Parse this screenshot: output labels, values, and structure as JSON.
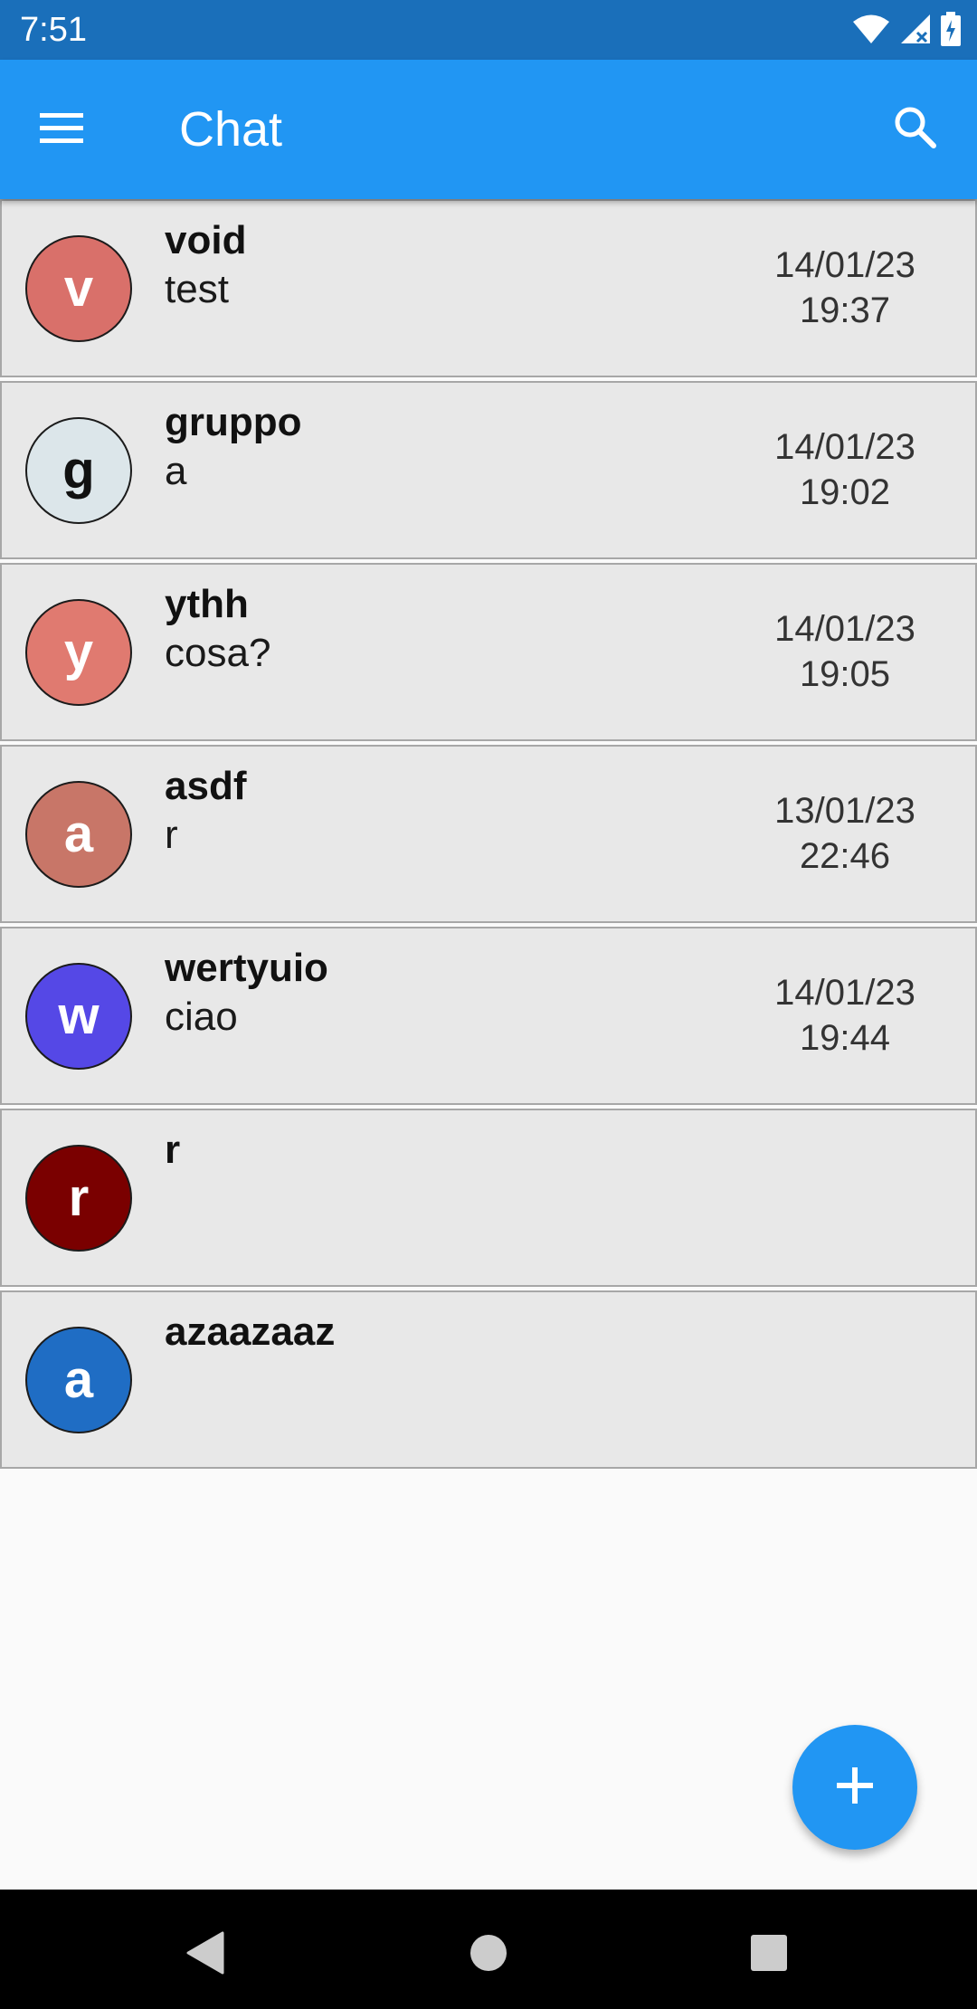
{
  "status_bar": {
    "time": "7:51",
    "icons": [
      "wifi-icon",
      "cellular-signal-icon",
      "battery-charging-icon"
    ]
  },
  "app_bar": {
    "title": "Chat",
    "menu_icon": "hamburger-menu-icon",
    "search_icon": "search-icon",
    "color": "#2196f3"
  },
  "chats": [
    {
      "initial": "v",
      "name": "void",
      "message": "test",
      "date": "14/01/23",
      "time": "19:37",
      "avatar_color": "#d9706a",
      "avatar_text_color": "#ffffff"
    },
    {
      "initial": "g",
      "name": "gruppo",
      "message": "a",
      "date": "14/01/23",
      "time": "19:02",
      "avatar_color": "#dce6ea",
      "avatar_text_color": "#111111"
    },
    {
      "initial": "y",
      "name": "ythh",
      "message": "cosa?",
      "date": "14/01/23",
      "time": "19:05",
      "avatar_color": "#e07a70",
      "avatar_text_color": "#ffffff"
    },
    {
      "initial": "a",
      "name": "asdf",
      "message": "r",
      "date": "13/01/23",
      "time": "22:46",
      "avatar_color": "#c87668",
      "avatar_text_color": "#ffffff"
    },
    {
      "initial": "w",
      "name": "wertyuio",
      "message": "ciao",
      "date": "14/01/23",
      "time": "19:44",
      "avatar_color": "#5548e6",
      "avatar_text_color": "#ffffff"
    },
    {
      "initial": "r",
      "name": "r",
      "message": "",
      "date": "",
      "time": "",
      "avatar_color": "#7a0000",
      "avatar_text_color": "#ffffff"
    },
    {
      "initial": "a",
      "name": "azaazaaz",
      "message": "",
      "date": "",
      "time": "",
      "avatar_color": "#1f6dc4",
      "avatar_text_color": "#ffffff"
    }
  ],
  "fab": {
    "icon": "plus-icon",
    "color": "#2196f3"
  },
  "nav_bar": {
    "icons": [
      "back-triangle-icon",
      "home-circle-icon",
      "recents-square-icon"
    ]
  }
}
